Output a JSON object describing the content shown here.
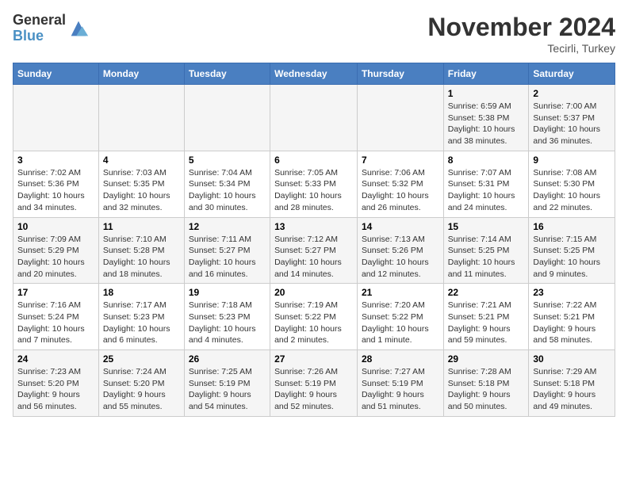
{
  "header": {
    "logo_general": "General",
    "logo_blue": "Blue",
    "title": "November 2024",
    "location": "Tecirli, Turkey"
  },
  "weekdays": [
    "Sunday",
    "Monday",
    "Tuesday",
    "Wednesday",
    "Thursday",
    "Friday",
    "Saturday"
  ],
  "rows": [
    [
      {
        "day": "",
        "info": ""
      },
      {
        "day": "",
        "info": ""
      },
      {
        "day": "",
        "info": ""
      },
      {
        "day": "",
        "info": ""
      },
      {
        "day": "",
        "info": ""
      },
      {
        "day": "1",
        "info": "Sunrise: 6:59 AM\nSunset: 5:38 PM\nDaylight: 10 hours\nand 38 minutes."
      },
      {
        "day": "2",
        "info": "Sunrise: 7:00 AM\nSunset: 5:37 PM\nDaylight: 10 hours\nand 36 minutes."
      }
    ],
    [
      {
        "day": "3",
        "info": "Sunrise: 7:02 AM\nSunset: 5:36 PM\nDaylight: 10 hours\nand 34 minutes."
      },
      {
        "day": "4",
        "info": "Sunrise: 7:03 AM\nSunset: 5:35 PM\nDaylight: 10 hours\nand 32 minutes."
      },
      {
        "day": "5",
        "info": "Sunrise: 7:04 AM\nSunset: 5:34 PM\nDaylight: 10 hours\nand 30 minutes."
      },
      {
        "day": "6",
        "info": "Sunrise: 7:05 AM\nSunset: 5:33 PM\nDaylight: 10 hours\nand 28 minutes."
      },
      {
        "day": "7",
        "info": "Sunrise: 7:06 AM\nSunset: 5:32 PM\nDaylight: 10 hours\nand 26 minutes."
      },
      {
        "day": "8",
        "info": "Sunrise: 7:07 AM\nSunset: 5:31 PM\nDaylight: 10 hours\nand 24 minutes."
      },
      {
        "day": "9",
        "info": "Sunrise: 7:08 AM\nSunset: 5:30 PM\nDaylight: 10 hours\nand 22 minutes."
      }
    ],
    [
      {
        "day": "10",
        "info": "Sunrise: 7:09 AM\nSunset: 5:29 PM\nDaylight: 10 hours\nand 20 minutes."
      },
      {
        "day": "11",
        "info": "Sunrise: 7:10 AM\nSunset: 5:28 PM\nDaylight: 10 hours\nand 18 minutes."
      },
      {
        "day": "12",
        "info": "Sunrise: 7:11 AM\nSunset: 5:27 PM\nDaylight: 10 hours\nand 16 minutes."
      },
      {
        "day": "13",
        "info": "Sunrise: 7:12 AM\nSunset: 5:27 PM\nDaylight: 10 hours\nand 14 minutes."
      },
      {
        "day": "14",
        "info": "Sunrise: 7:13 AM\nSunset: 5:26 PM\nDaylight: 10 hours\nand 12 minutes."
      },
      {
        "day": "15",
        "info": "Sunrise: 7:14 AM\nSunset: 5:25 PM\nDaylight: 10 hours\nand 11 minutes."
      },
      {
        "day": "16",
        "info": "Sunrise: 7:15 AM\nSunset: 5:25 PM\nDaylight: 10 hours\nand 9 minutes."
      }
    ],
    [
      {
        "day": "17",
        "info": "Sunrise: 7:16 AM\nSunset: 5:24 PM\nDaylight: 10 hours\nand 7 minutes."
      },
      {
        "day": "18",
        "info": "Sunrise: 7:17 AM\nSunset: 5:23 PM\nDaylight: 10 hours\nand 6 minutes."
      },
      {
        "day": "19",
        "info": "Sunrise: 7:18 AM\nSunset: 5:23 PM\nDaylight: 10 hours\nand 4 minutes."
      },
      {
        "day": "20",
        "info": "Sunrise: 7:19 AM\nSunset: 5:22 PM\nDaylight: 10 hours\nand 2 minutes."
      },
      {
        "day": "21",
        "info": "Sunrise: 7:20 AM\nSunset: 5:22 PM\nDaylight: 10 hours\nand 1 minute."
      },
      {
        "day": "22",
        "info": "Sunrise: 7:21 AM\nSunset: 5:21 PM\nDaylight: 9 hours\nand 59 minutes."
      },
      {
        "day": "23",
        "info": "Sunrise: 7:22 AM\nSunset: 5:21 PM\nDaylight: 9 hours\nand 58 minutes."
      }
    ],
    [
      {
        "day": "24",
        "info": "Sunrise: 7:23 AM\nSunset: 5:20 PM\nDaylight: 9 hours\nand 56 minutes."
      },
      {
        "day": "25",
        "info": "Sunrise: 7:24 AM\nSunset: 5:20 PM\nDaylight: 9 hours\nand 55 minutes."
      },
      {
        "day": "26",
        "info": "Sunrise: 7:25 AM\nSunset: 5:19 PM\nDaylight: 9 hours\nand 54 minutes."
      },
      {
        "day": "27",
        "info": "Sunrise: 7:26 AM\nSunset: 5:19 PM\nDaylight: 9 hours\nand 52 minutes."
      },
      {
        "day": "28",
        "info": "Sunrise: 7:27 AM\nSunset: 5:19 PM\nDaylight: 9 hours\nand 51 minutes."
      },
      {
        "day": "29",
        "info": "Sunrise: 7:28 AM\nSunset: 5:18 PM\nDaylight: 9 hours\nand 50 minutes."
      },
      {
        "day": "30",
        "info": "Sunrise: 7:29 AM\nSunset: 5:18 PM\nDaylight: 9 hours\nand 49 minutes."
      }
    ]
  ]
}
